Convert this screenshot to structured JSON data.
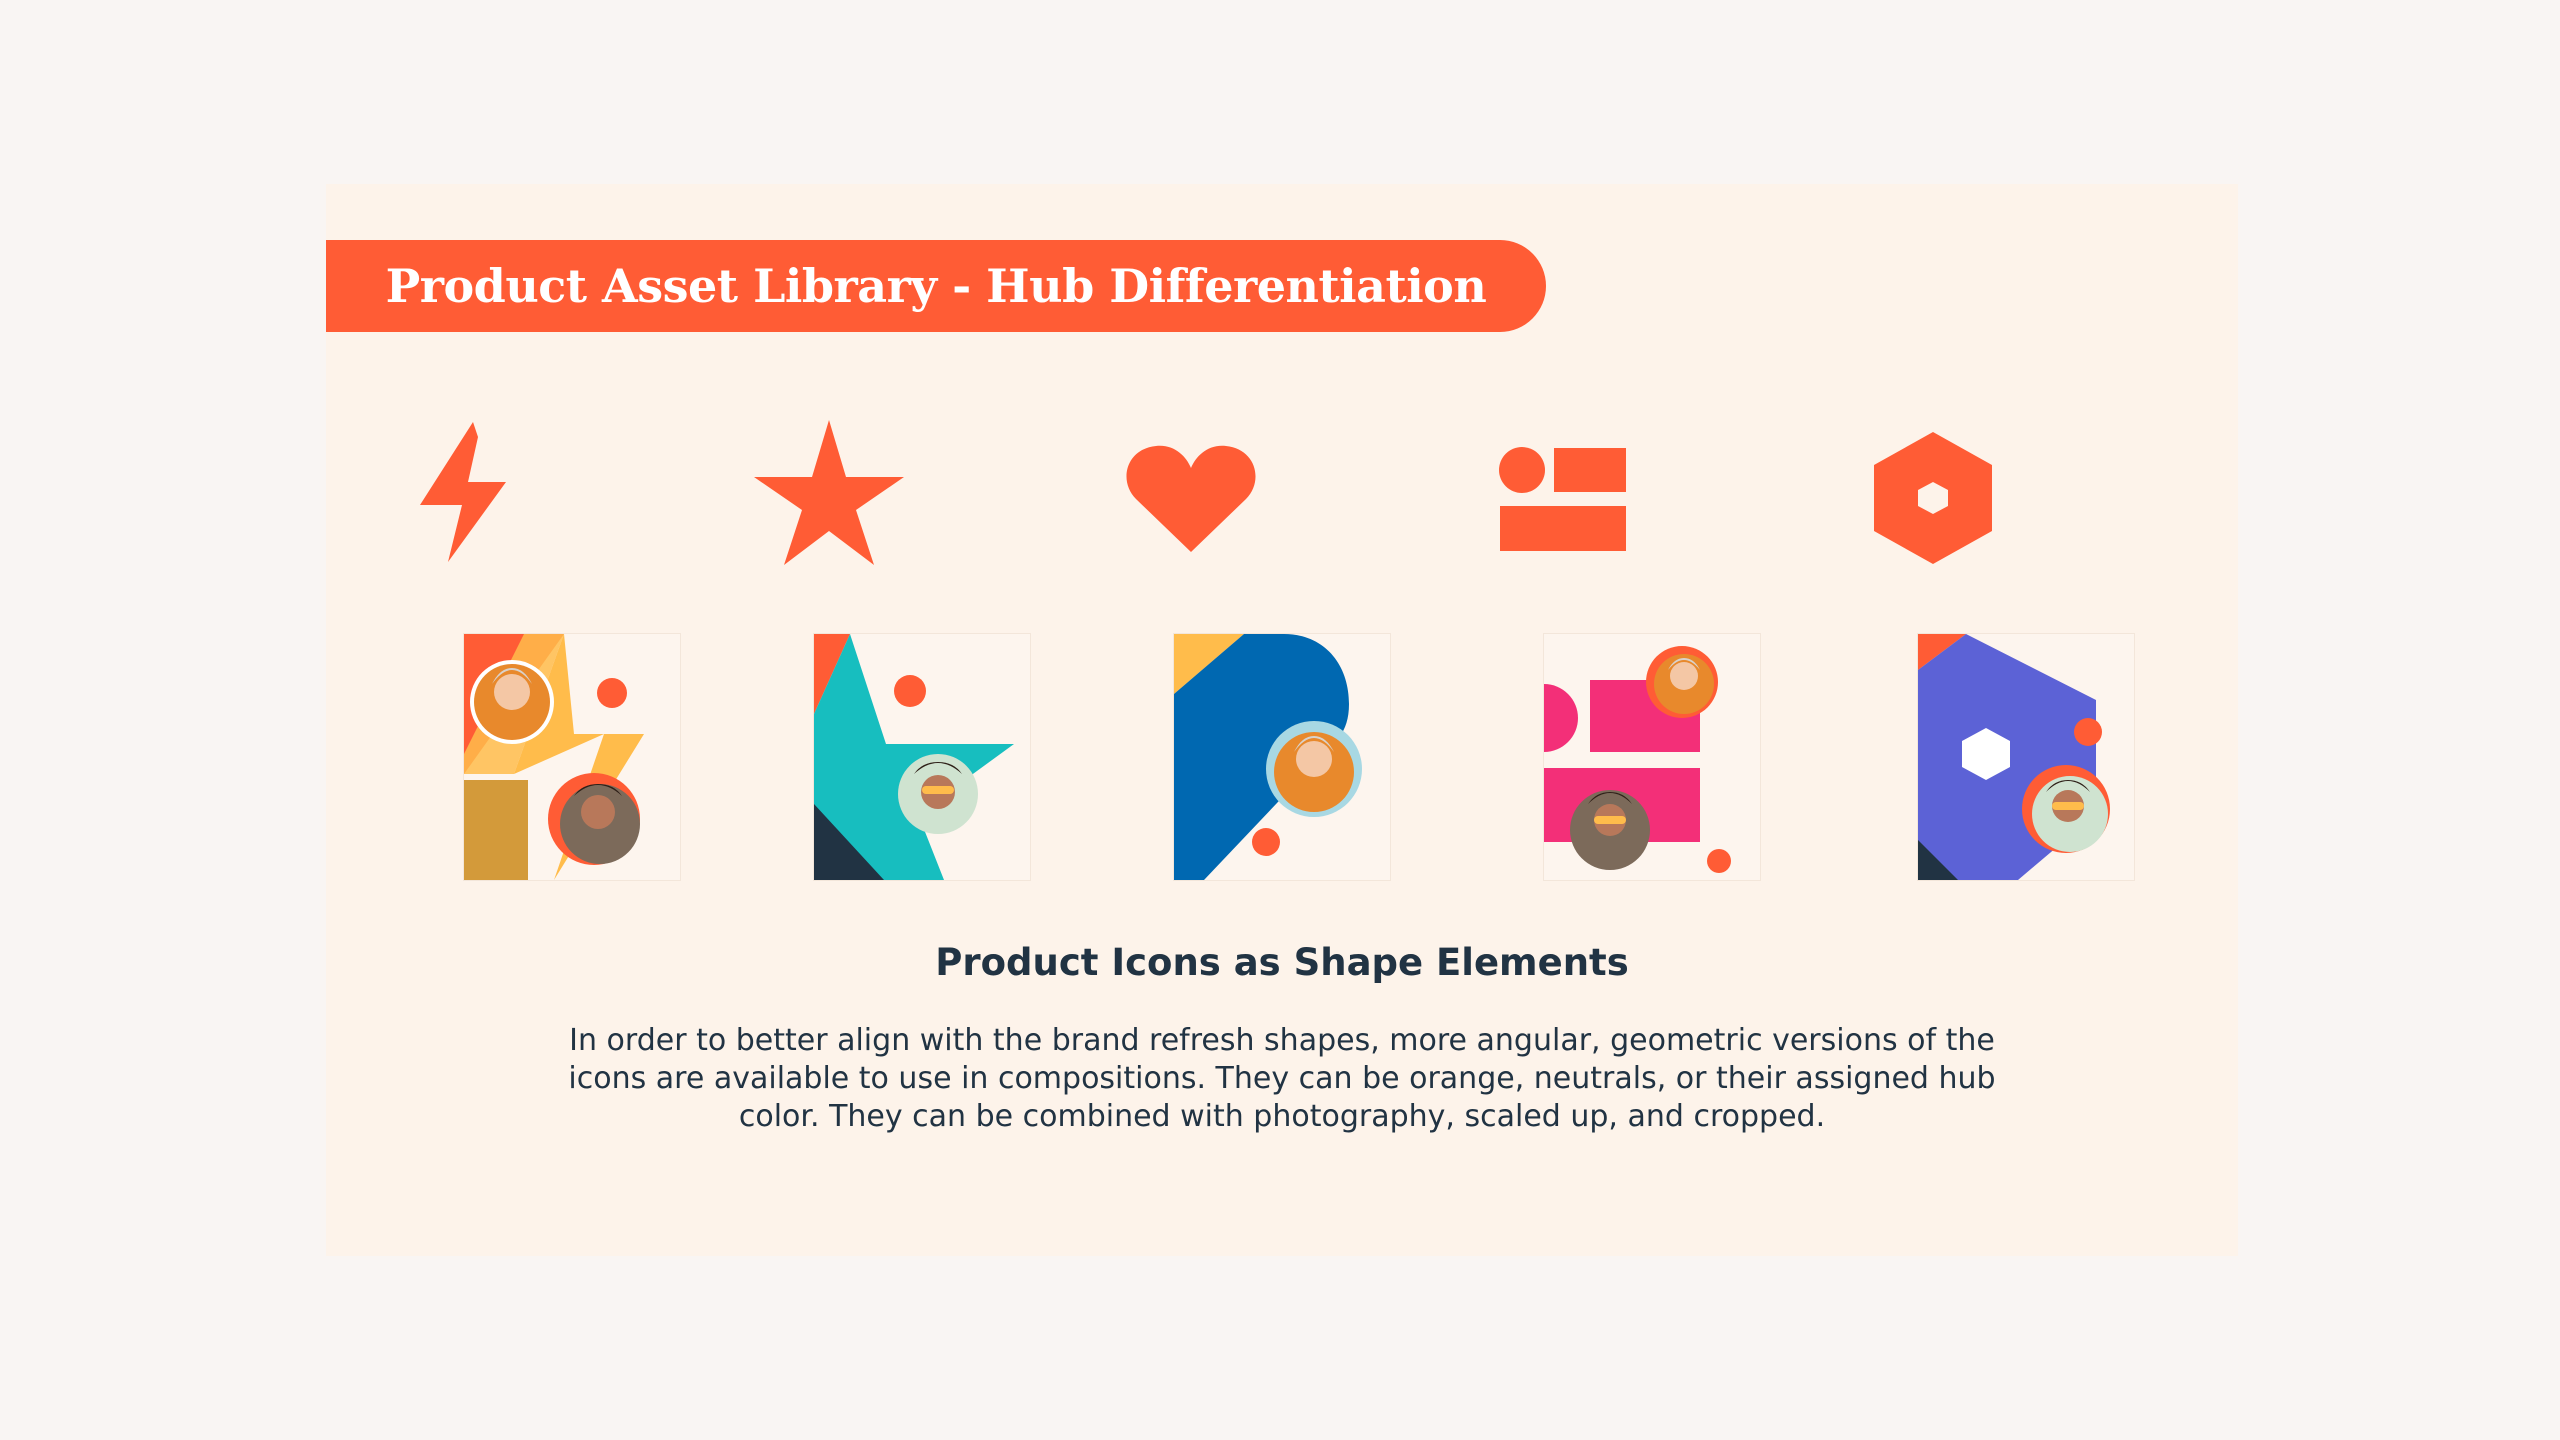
{
  "banner": {
    "title": "Product Asset Library - Hub Differentiation"
  },
  "icons": [
    {
      "name": "lightning-bolt-icon"
    },
    {
      "name": "star-icon"
    },
    {
      "name": "heart-icon"
    },
    {
      "name": "circle-and-bars-icon"
    },
    {
      "name": "hexagon-icon"
    }
  ],
  "compositions": [
    {
      "name": "lightning-composition",
      "hub_color": "#ffbc4b"
    },
    {
      "name": "star-composition",
      "hub_color": "#17bebf"
    },
    {
      "name": "heart-composition",
      "hub_color": "#0068b1"
    },
    {
      "name": "bars-composition",
      "hub_color": "#f32f78"
    },
    {
      "name": "hexagon-composition",
      "hub_color": "#5c62d6"
    }
  ],
  "section": {
    "title": "Product Icons as Shape Elements",
    "description": "In order to better align with the brand refresh shapes, more angular, geometric versions of the icons are available to use in compositions. They can be orange, neutrals, or their assigned hub color. They can be combined with photography, scaled up, and cropped."
  },
  "colors": {
    "accent": "#ff5c35",
    "background": "#fdf3ea",
    "page": "#f9f5f3",
    "text": "#213343"
  }
}
